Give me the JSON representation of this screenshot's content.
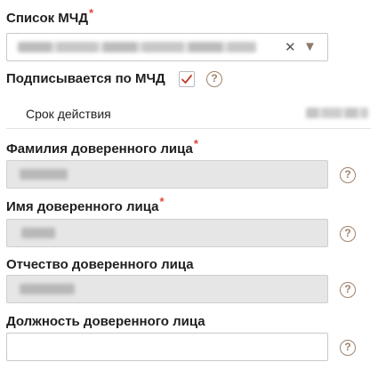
{
  "mchd_list": {
    "label": "Список МЧД",
    "required_mark": "*",
    "clear_glyph": "✕",
    "arrow_glyph": "▼"
  },
  "signs_by_mchd": {
    "label": "Подписывается по МЧД",
    "checked": true,
    "help_glyph": "?"
  },
  "validity": {
    "label": "Срок действия"
  },
  "trustee_surname": {
    "label": "Фамилия доверенного лица",
    "required_mark": "*",
    "help_glyph": "?"
  },
  "trustee_name": {
    "label": "Имя доверенного лица",
    "required_mark": "*",
    "help_glyph": "?"
  },
  "trustee_patronymic": {
    "label": "Отчество доверенного лица",
    "help_glyph": "?"
  },
  "trustee_position": {
    "label": "Должность доверенного лица",
    "value": "",
    "help_glyph": "?"
  },
  "colors": {
    "required": "#e0453a",
    "accent": "#a0826a",
    "check": "#c0392b",
    "disabled_bg": "#e6e6e6"
  }
}
